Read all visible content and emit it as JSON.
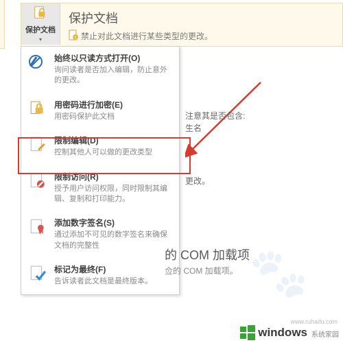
{
  "banner": {
    "button_label": "保护文档",
    "title": "保护文档",
    "subtitle": "禁止对此文档进行某些类型的更改。"
  },
  "menu": {
    "items": [
      {
        "title": "始终以只读方式打开(O)",
        "desc": "询问读者是否加入编辑，防止意外的更改。"
      },
      {
        "title": "用密码进行加密(E)",
        "desc": "用密码保护此文档"
      },
      {
        "title": "限制编辑(D)",
        "desc": "控制其他人可以做的更改类型"
      },
      {
        "title": "限制访问(R)",
        "desc": "授予用户访问权限，同时限制其编辑、复制和打印能力。"
      },
      {
        "title": "添加数字签名(S)",
        "desc": "通过添加不可见的数字签名来确保文档的完整性"
      },
      {
        "title": "标记为最终(F)",
        "desc": "告诉读者此文档是最终版本。"
      }
    ]
  },
  "side": {
    "line1": "注意其是否包含:",
    "line2": "生名",
    "line3": "更改。"
  },
  "com": {
    "title": "的 COM 加载项",
    "sub": "佥的 COM 加载项。"
  },
  "watermark": {
    "text": "windows",
    "sub": "系统家园",
    "url": "www.ruhaifu.com"
  }
}
